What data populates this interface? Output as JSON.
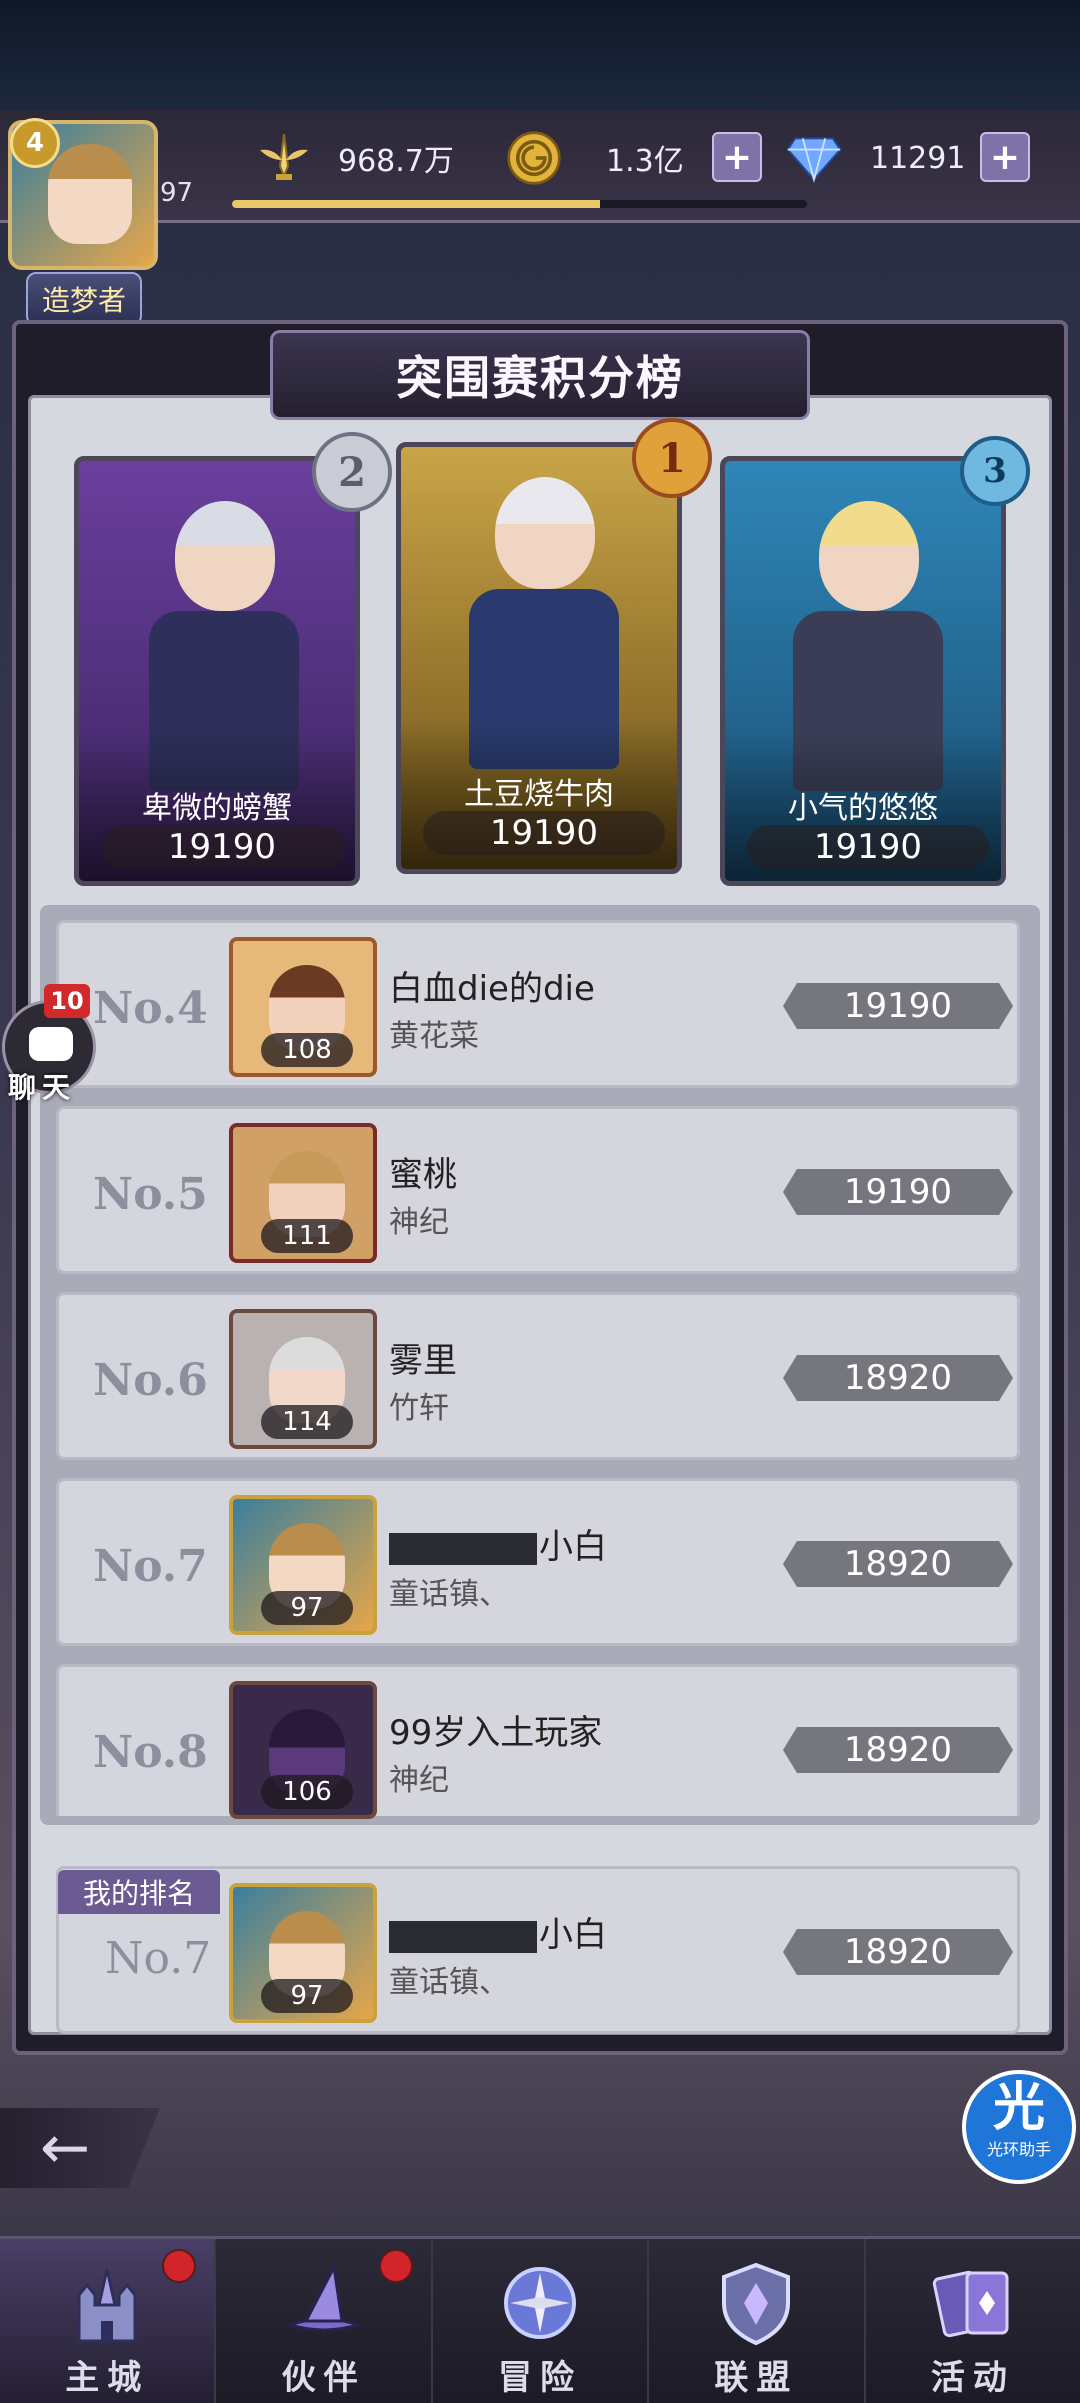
{
  "player": {
    "avatar_level_badge": "4",
    "level": "97",
    "title": "造梦者",
    "exp_progress": 0.64
  },
  "resources": {
    "power": {
      "icon": "sword-wings-icon",
      "value": "968.7万"
    },
    "gold": {
      "icon": "gold-coin-icon",
      "value": "1.3亿"
    },
    "diamond": {
      "icon": "diamond-icon",
      "value": "11291"
    }
  },
  "leaderboard": {
    "title": "突围赛积分榜",
    "podium": [
      {
        "rank": "2",
        "name": "卑微的螃蟹",
        "score": "19190"
      },
      {
        "rank": "1",
        "name": "土豆烧牛肉",
        "score": "19190"
      },
      {
        "rank": "3",
        "name": "小气的悠悠",
        "score": "19190"
      }
    ],
    "rows": [
      {
        "rank": "No.4",
        "level": "108",
        "name": "白血die的die",
        "guild": "黄花菜",
        "score": "19190"
      },
      {
        "rank": "No.5",
        "level": "111",
        "name": "蜜桃",
        "guild": "神纪",
        "score": "19190"
      },
      {
        "rank": "No.6",
        "level": "114",
        "name": "雾里",
        "guild": "竹轩",
        "score": "18920"
      },
      {
        "rank": "No.7",
        "level": "97",
        "name": "小白",
        "guild": "童话镇、",
        "score": "18920"
      },
      {
        "rank": "No.8",
        "level": "106",
        "name": "99岁入土玩家",
        "guild": "神纪",
        "score": "18920"
      }
    ],
    "my_rank": {
      "tag": "我的排名",
      "rank": "No.7",
      "level": "97",
      "name": "小白",
      "guild": "童话镇、",
      "score": "18920"
    }
  },
  "chat": {
    "badge": "10",
    "label": "聊天"
  },
  "helper": {
    "big": "光",
    "small": "光环助手"
  },
  "nav": [
    {
      "label": "主城",
      "icon": "castle-icon",
      "has_dot": true
    },
    {
      "label": "伙伴",
      "icon": "witch-hat-icon",
      "has_dot": true
    },
    {
      "label": "冒险",
      "icon": "compass-orb-icon",
      "has_dot": false
    },
    {
      "label": "联盟",
      "icon": "shield-crest-icon",
      "has_dot": false
    },
    {
      "label": "活动",
      "icon": "cards-icon",
      "has_dot": false
    }
  ]
}
